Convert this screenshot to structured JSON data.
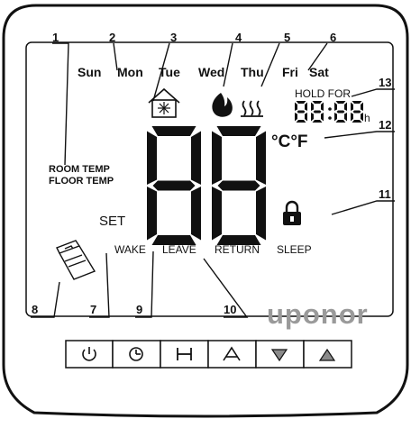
{
  "days": [
    "Sun",
    "Mon",
    "Tue",
    "Wed",
    "Thu",
    "Fri",
    "Sat"
  ],
  "callouts": [
    "1",
    "2",
    "3",
    "4",
    "5",
    "6",
    "7",
    "8",
    "9",
    "10",
    "11",
    "12",
    "13"
  ],
  "hold_for": "HOLD FOR",
  "hold_digits": "88:88",
  "hold_unit": "h",
  "big_digits": "88",
  "units": "°C°F",
  "room_temp": "ROOM TEMP",
  "floor_temp": "FLOOR TEMP",
  "set": "SET",
  "modes": [
    "WAKE",
    "LEAVE",
    "RETURN",
    "SLEEP"
  ],
  "brand": "uponor",
  "buttons": [
    {
      "name": "power",
      "icon": "power-icon"
    },
    {
      "name": "clock",
      "icon": "clock-icon"
    },
    {
      "name": "holiday",
      "icon": "h-icon"
    },
    {
      "name": "up-outline",
      "icon": "outline-up-arrow-icon"
    },
    {
      "name": "down",
      "icon": "down-arrow-icon"
    },
    {
      "name": "up",
      "icon": "up-arrow-icon"
    }
  ]
}
